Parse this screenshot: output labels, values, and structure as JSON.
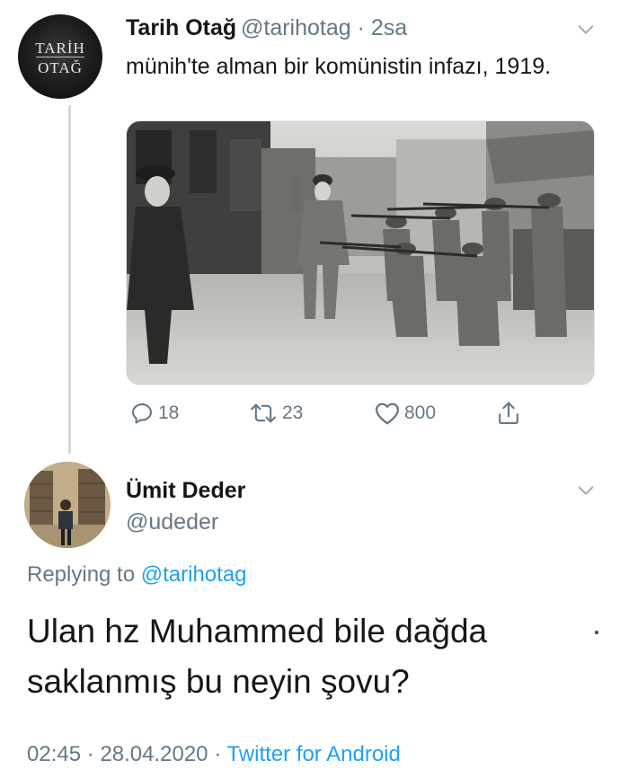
{
  "tweet": {
    "author_name": "Tarih Otağ",
    "handle": "@tarihotag",
    "separator": "·",
    "time": "2sa",
    "text": "münih'te alman bir komünistin infazı, 1919.",
    "avatar_logo_line1": "TARİH",
    "avatar_logo_line2": "OTAĞ",
    "actions": {
      "reply_count": "18",
      "retweet_count": "23",
      "like_count": "800"
    }
  },
  "reply": {
    "author_name": "Ümit Deder",
    "handle": "@udeder",
    "replying_prefix": "Replying to",
    "replying_to": "@tarihotag",
    "text": "Ulan hz Muhammed bile dağda saklanmış bu neyin şovu?",
    "time": "02:45",
    "separator": "·",
    "date": "28.04.2020",
    "source": "Twitter for Android"
  },
  "colors": {
    "accent": "#1da1f2",
    "secondary_text": "#657786",
    "primary_text": "#14171a",
    "thread_line": "#cfd9de"
  },
  "icons": [
    "reply-icon",
    "retweet-icon",
    "like-icon",
    "share-icon",
    "chevron-down-icon"
  ]
}
